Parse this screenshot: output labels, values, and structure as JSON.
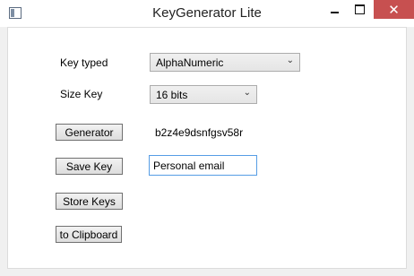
{
  "window": {
    "title": "KeyGenerator Lite",
    "minimize_glyph": "",
    "close_glyph": "✕"
  },
  "form": {
    "key_typed_label": "Key typed",
    "key_typed_value": "AlphaNumeric",
    "size_key_label": "Size Key",
    "size_key_value": "16 bits",
    "chevron": "⌄",
    "generator_button": "Generator",
    "generated_key": "b2z4e9dsnfgsv58r",
    "save_key_button": "Save Key",
    "save_key_name": "Personal email",
    "store_keys_button": "Store Keys",
    "clipboard_button": "to Clipboard"
  },
  "colors": {
    "close_button": "#c75050",
    "textbox_focus_border": "#569de5"
  }
}
